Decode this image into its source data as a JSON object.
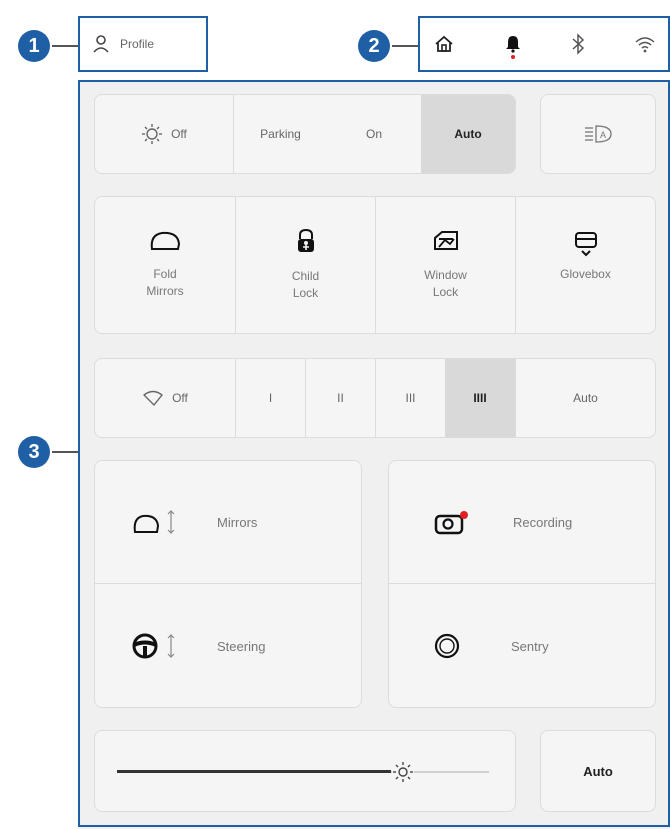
{
  "callouts": {
    "one": "1",
    "two": "2",
    "three": "3"
  },
  "profile": {
    "label": "Profile"
  },
  "status_icons": [
    "home-icon",
    "bell-icon",
    "bluetooth-icon",
    "wifi-icon"
  ],
  "lights": {
    "off_label": "Off",
    "options": [
      "Parking",
      "On",
      "Auto"
    ],
    "selected": "Auto"
  },
  "quick_controls": [
    {
      "label": "Fold Mirrors",
      "line1": "Fold",
      "line2": "Mirrors",
      "icon": "mirror-fold-icon"
    },
    {
      "label": "Child Lock",
      "line1": "Child",
      "line2": "Lock",
      "icon": "child-lock-icon"
    },
    {
      "label": "Window Lock",
      "line1": "Window",
      "line2": "Lock",
      "icon": "window-lock-icon"
    },
    {
      "label": "Glovebox",
      "line1": "Glovebox",
      "line2": "",
      "icon": "glovebox-icon"
    }
  ],
  "wipers": {
    "off_label": "Off",
    "speeds": [
      "I",
      "II",
      "III",
      "IIII"
    ],
    "auto_label": "Auto",
    "selected": "IIII"
  },
  "adjust": {
    "mirrors_label": "Mirrors",
    "steering_label": "Steering",
    "recording_label": "Recording",
    "sentry_label": "Sentry"
  },
  "display": {
    "auto_label": "Auto",
    "brightness": 0.77
  },
  "colors": {
    "callout": "#1f5fa6",
    "highlight": "#1f5fa6",
    "recording_dot": "#e02020",
    "notification_dot": "#e02020"
  }
}
